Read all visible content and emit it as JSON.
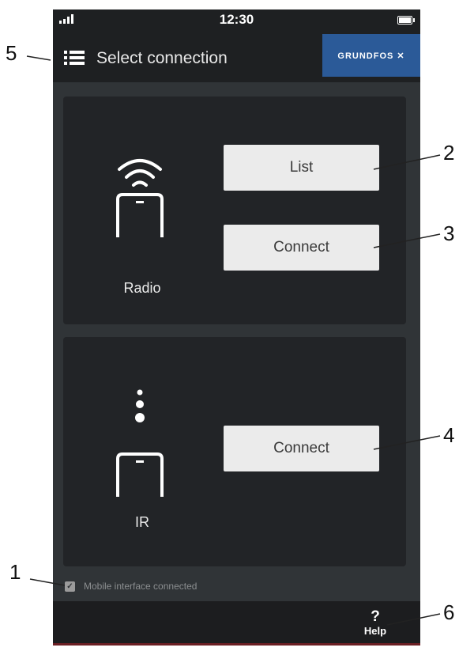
{
  "status_bar": {
    "time": "12:30",
    "signal_icon": "signal-bars-icon",
    "battery_icon": "battery-icon"
  },
  "header": {
    "menu_icon": "list-menu-icon",
    "title": "Select connection",
    "logo_text": "GRUNDFOS ✕"
  },
  "radio_panel": {
    "icon": "wifi-phone-icon",
    "label": "Radio",
    "buttons": {
      "list": "List",
      "connect": "Connect"
    }
  },
  "ir_panel": {
    "icon": "ir-phone-icon",
    "label": "IR",
    "buttons": {
      "connect": "Connect"
    }
  },
  "status": {
    "checked": true,
    "label": "Mobile interface connected"
  },
  "bottom_bar": {
    "help_symbol": "?",
    "help_label": "Help"
  },
  "callouts": [
    "1",
    "2",
    "3",
    "4",
    "5",
    "6"
  ],
  "colors": {
    "background": "#303437",
    "panel": "#222427",
    "header": "#1e2022",
    "button": "#ebebeb",
    "logo": "#2b5a98"
  }
}
